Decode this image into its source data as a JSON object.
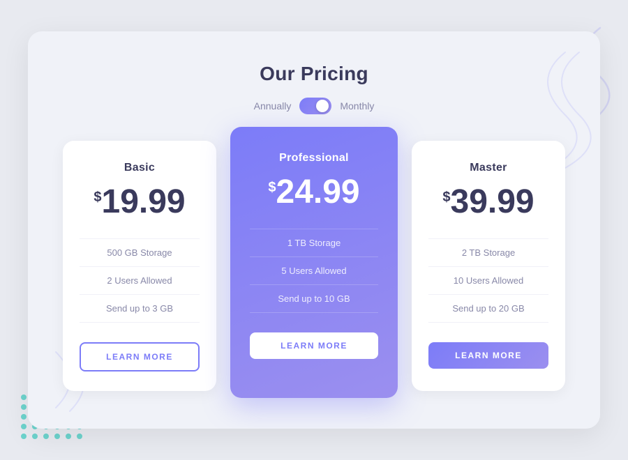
{
  "page": {
    "background_color": "#e8eaf0"
  },
  "header": {
    "title": "Our Pricing",
    "toggle": {
      "label_left": "Annually",
      "label_right": "Monthly",
      "is_monthly": true
    }
  },
  "plans": [
    {
      "id": "basic",
      "name": "Basic",
      "currency": "$",
      "price": "19.99",
      "features": [
        "500 GB Storage",
        "2 Users Allowed",
        "Send up to 3 GB"
      ],
      "button_label": "LEARN MORE",
      "button_style": "outline-purple",
      "featured": false
    },
    {
      "id": "professional",
      "name": "Professional",
      "currency": "$",
      "price": "24.99",
      "features": [
        "1 TB Storage",
        "5 Users Allowed",
        "Send up to 10 GB"
      ],
      "button_label": "LEARN MORE",
      "button_style": "white-btn",
      "featured": true
    },
    {
      "id": "master",
      "name": "Master",
      "currency": "$",
      "price": "39.99",
      "features": [
        "2 TB Storage",
        "10 Users Allowed",
        "Send up to 20 GB"
      ],
      "button_label": "LEARN MORE",
      "button_style": "solid-purple",
      "featured": false
    }
  ],
  "decorations": {
    "dots_color": "#4ecdc4",
    "accent_color": "#7c7cf8"
  }
}
